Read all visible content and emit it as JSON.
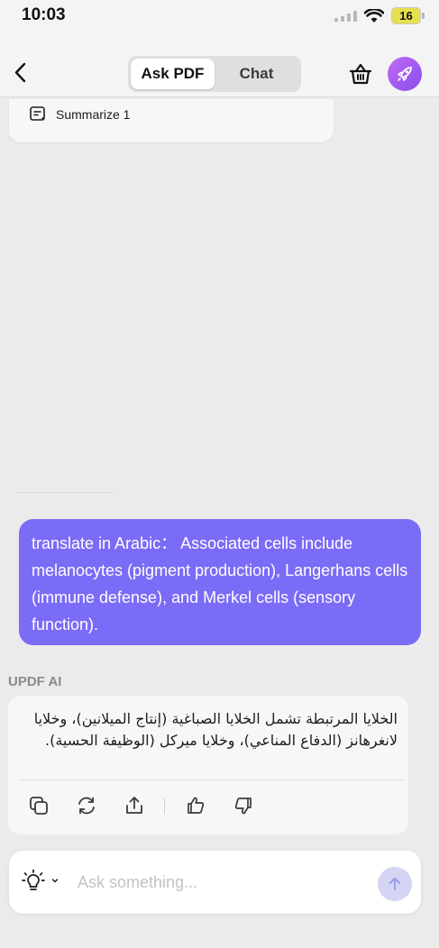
{
  "status": {
    "time": "10:03",
    "battery": "16"
  },
  "nav": {
    "tabs": [
      {
        "label": "Ask PDF",
        "active": true
      },
      {
        "label": "Chat",
        "active": false
      }
    ]
  },
  "summary": {
    "label": "Summarize 1"
  },
  "user_message": {
    "text": "translate in Arabic：  Associated cells include melanocytes (pigment production), Langerhans cells (immune defense), and Merkel cells (sensory function)."
  },
  "ai": {
    "label": "UPDF AI",
    "response": "الخلايا المرتبطة تشمل الخلايا الصباغية (إنتاج الميلانين)، وخلايا لانغرهانز (الدفاع المناعي)، وخلايا ميركل (الوظيفة الحسية)."
  },
  "input": {
    "placeholder": "Ask something..."
  },
  "colors": {
    "accent": "#7a6cf6",
    "background": "#ebebec",
    "brand_gradient_start": "#c06bf2",
    "brand_gradient_end": "#8a4df0"
  }
}
